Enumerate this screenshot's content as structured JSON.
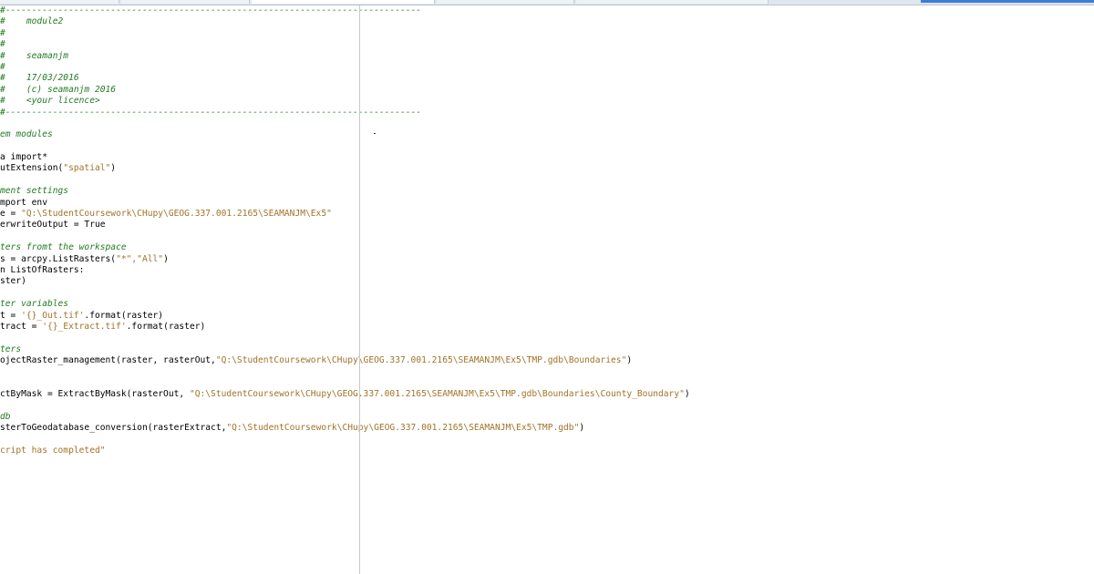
{
  "editor": {
    "lines": [
      [
        {
          "t": "#-------------------------------------------------------------------------------",
          "c": "comment"
        }
      ],
      [
        {
          "t": "#    module2",
          "c": "comment"
        }
      ],
      [
        {
          "t": "#",
          "c": "comment"
        }
      ],
      [
        {
          "t": "#",
          "c": "comment"
        }
      ],
      [
        {
          "t": "#    seamanjm",
          "c": "comment"
        }
      ],
      [
        {
          "t": "#",
          "c": "comment"
        }
      ],
      [
        {
          "t": "#    17/03/2016",
          "c": "comment"
        }
      ],
      [
        {
          "t": "#    (c) seamanjm 2016",
          "c": "comment"
        }
      ],
      [
        {
          "t": "#    <your licence>",
          "c": "comment"
        }
      ],
      [
        {
          "t": "#-------------------------------------------------------------------------------",
          "c": "comment"
        }
      ],
      [],
      [
        {
          "t": "em modules",
          "c": "comment"
        }
      ],
      [],
      [
        {
          "t": "a import*",
          "c": "plain"
        }
      ],
      [
        {
          "t": "utExtension(",
          "c": "plain"
        },
        {
          "t": "\"spatial\"",
          "c": "string"
        },
        {
          "t": ")",
          "c": "plain"
        }
      ],
      [],
      [
        {
          "t": "ment settings",
          "c": "comment"
        }
      ],
      [
        {
          "t": "mport env",
          "c": "plain"
        }
      ],
      [
        {
          "t": "e = ",
          "c": "plain"
        },
        {
          "t": "\"Q:\\StudentCoursework\\CHupy\\GEOG.337.001.2165\\SEAMANJM\\Ex5\"",
          "c": "string"
        }
      ],
      [
        {
          "t": "erwriteOutput = True",
          "c": "plain"
        }
      ],
      [],
      [
        {
          "t": "ters fromt the workspace",
          "c": "comment"
        }
      ],
      [
        {
          "t": "s = arcpy.ListRasters(",
          "c": "plain"
        },
        {
          "t": "\"*\",\"All\"",
          "c": "string"
        },
        {
          "t": ")",
          "c": "plain"
        }
      ],
      [
        {
          "t": "n ListOfRasters:",
          "c": "plain"
        }
      ],
      [
        {
          "t": "ster)",
          "c": "plain"
        }
      ],
      [],
      [
        {
          "t": "ter variables",
          "c": "comment"
        }
      ],
      [
        {
          "t": "t = ",
          "c": "plain"
        },
        {
          "t": "'{}_Out.tif'",
          "c": "string"
        },
        {
          "t": ".format(raster)",
          "c": "plain"
        }
      ],
      [
        {
          "t": "tract = ",
          "c": "plain"
        },
        {
          "t": "'{}_Extract.tif'",
          "c": "string"
        },
        {
          "t": ".format(raster)",
          "c": "plain"
        }
      ],
      [],
      [
        {
          "t": "ters",
          "c": "comment"
        }
      ],
      [
        {
          "t": "ojectRaster_management(raster, rasterOut,",
          "c": "plain"
        },
        {
          "t": "\"Q:\\StudentCoursework\\CHupy\\GEOG.337.001.2165\\SEAMANJM\\Ex5\\TMP.gdb\\Boundaries\"",
          "c": "string"
        },
        {
          "t": ")",
          "c": "plain"
        }
      ],
      [],
      [],
      [
        {
          "t": "ctByMask = ExtractByMask(rasterOut, ",
          "c": "plain"
        },
        {
          "t": "\"Q:\\StudentCoursework\\CHupy\\GEOG.337.001.2165\\SEAMANJM\\Ex5\\TMP.gdb\\Boundaries\\County_Boundary\"",
          "c": "string"
        },
        {
          "t": ")",
          "c": "plain"
        }
      ],
      [],
      [
        {
          "t": "db",
          "c": "comment"
        }
      ],
      [
        {
          "t": "sterToGeodatabase_conversion(rasterExtract,",
          "c": "plain"
        },
        {
          "t": "\"Q:\\StudentCoursework\\CHupy\\GEOG.337.001.2165\\SEAMANJM\\Ex5\\TMP.gdb\"",
          "c": "string"
        },
        {
          "t": ")",
          "c": "plain"
        }
      ],
      [],
      [
        {
          "t": "cript has completed\"",
          "c": "string"
        }
      ]
    ]
  },
  "tabs": {
    "count": 5
  },
  "colors": {
    "comment": "#237a23",
    "string": "#a0732a",
    "plain": "#000000",
    "edge_line": "#c8c8c8",
    "tab_accent": "#3b7dd8"
  }
}
